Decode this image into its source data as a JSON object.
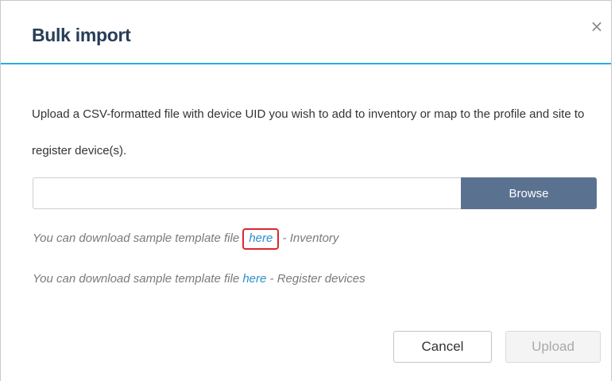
{
  "dialog": {
    "title": "Bulk import",
    "close_symbol": "×",
    "description": "Upload a CSV-formatted file with device UID you wish to add to inventory or map to the profile and site to register device(s).",
    "file_input": {
      "value": "",
      "placeholder": ""
    },
    "browse_label": "Browse",
    "templates": [
      {
        "prefix": "You can download sample template file ",
        "link_label": "here",
        "separator": " - ",
        "suffix": "Inventory"
      },
      {
        "prefix": "You can download sample template file ",
        "link_label": "here",
        "separator": " - ",
        "suffix": "Register devices"
      }
    ],
    "cancel_label": "Cancel",
    "upload_label": "Upload"
  },
  "colors": {
    "title": "#283d57",
    "accent_line": "#27aee0",
    "browse_bg": "#5a7290",
    "link": "#2a8fcc",
    "highlight": "#d9282f"
  },
  "icons": {
    "close": "close-icon"
  }
}
